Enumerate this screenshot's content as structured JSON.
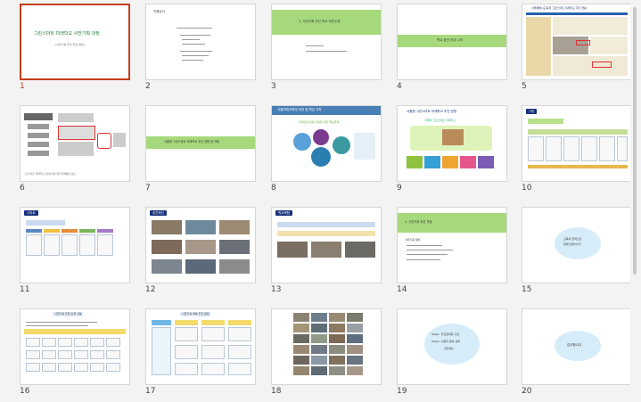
{
  "slides": [
    {
      "num": "1",
      "title": "그린스마트 미래학교 사전기획 과정",
      "subtitle": "(사전기획 추진 학교 대상)"
    },
    {
      "num": "2",
      "title": "진행순서"
    },
    {
      "num": "3",
      "heading": "1. 사전기획 추진 학교 의견수렴"
    },
    {
      "num": "4",
      "band": "학교 공간 조성 시작"
    },
    {
      "num": "5",
      "title": "서울특별시교육청 그린스마트 미래학교 추진 현황"
    },
    {
      "num": "6",
      "caption": "그린스마트 미래학교 1단계 사전기획 추진체계 흐름도"
    },
    {
      "num": "7",
      "band": "서울형 그린스마트 미래학교 추진 방향 및 과제"
    },
    {
      "num": "8",
      "title": "서울미래교육의 비전 및 핵심 가치",
      "subtitle": "미래교육 환경 구축을 위한 핵심과제"
    },
    {
      "num": "9",
      "title": "서울형 그린스마트 미래학교 추진 방향",
      "subtitle": "서울형 그린스마트 미래학교"
    },
    {
      "num": "10",
      "tab": "그린"
    },
    {
      "num": "11",
      "tab": "스마트"
    },
    {
      "num": "12",
      "tab": "공간혁신"
    },
    {
      "num": "13",
      "tab": "학교복합"
    },
    {
      "num": "14",
      "heading": "2. 사전기획 추진 과정",
      "subheading": "사전기획 절차"
    },
    {
      "num": "15",
      "bubble_line1": "교육과 협력으로",
      "bubble_line2": "함께 만들어가기"
    },
    {
      "num": "16",
      "title": "사전기획 추진 단계 구분"
    },
    {
      "num": "17",
      "title": "사전기획 세부 추진 일정"
    },
    {
      "num": "18"
    },
    {
      "num": "19",
      "bubble_line1": "Step1. 추진협의회 구성",
      "bubble_line2": "Step2. 사용자 참여 설계",
      "bubble_line3": "(협의회)"
    },
    {
      "num": "20",
      "bubble_line1": "감사합니다"
    }
  ],
  "selected_slide": "1",
  "colors": {
    "accent": "#c43e1c",
    "green": "#a6d97b",
    "navy": "#16307a",
    "bubble": "#d6ecf8"
  }
}
